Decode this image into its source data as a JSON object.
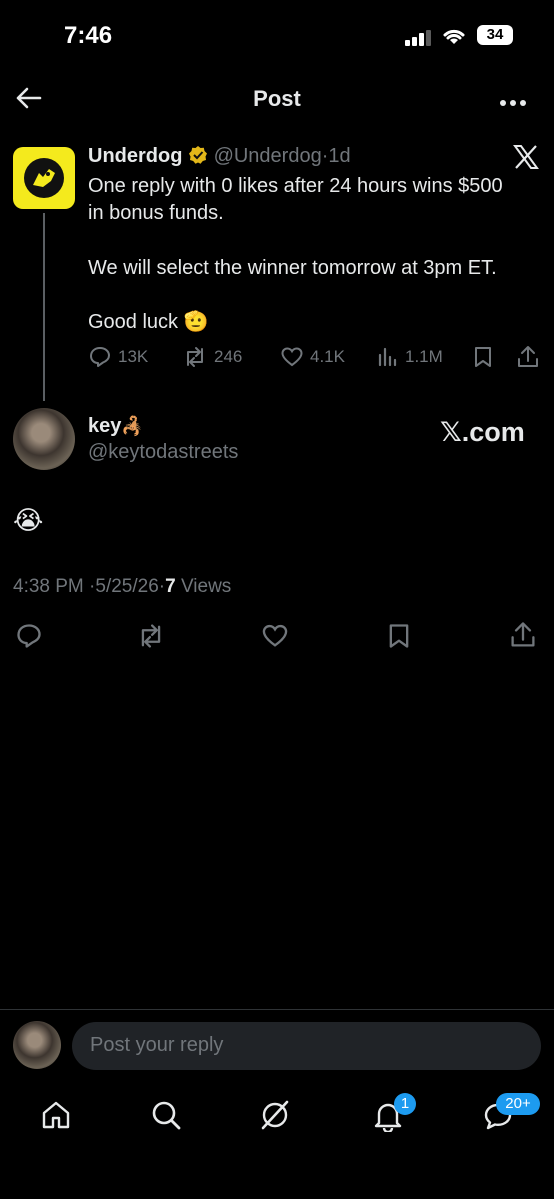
{
  "status_bar": {
    "time": "7:46",
    "battery": "34"
  },
  "header": {
    "title": "Post",
    "back_icon": "arrow-left-icon",
    "more_icon": "more-icon"
  },
  "original_post": {
    "author_name": "Underdog",
    "handle": "@Underdog",
    "separator": "·",
    "age": "1d",
    "text_line1": "One reply with 0 likes after 24 hours wins $500",
    "text_line2": "in bonus funds.",
    "text_line3": "We will select the winner tomorrow at 3pm ET.",
    "text_line4": "Good luck",
    "good_luck_emoji": "🫡",
    "stats": {
      "replies": "13K",
      "reposts": "246",
      "likes": "4.1K",
      "views": "1.1M"
    }
  },
  "reply": {
    "author_name": "key",
    "author_emoji": "🦂",
    "handle": "@keytodastreets",
    "watermark": "𝕏.com",
    "content": "😭",
    "time": "4:38 PM",
    "date": "5/25/26",
    "sep1": "·",
    "sep2": "·",
    "view_count": "7",
    "views_label": "Views"
  },
  "composer": {
    "placeholder": "Post your reply"
  },
  "tab_bar": {
    "notifications_badge": "1",
    "messages_badge": "20+"
  },
  "colors": {
    "accent": "#1d9bf0",
    "verified_gold": "#e2b719",
    "brand_yellow": "#f4ea1d"
  }
}
